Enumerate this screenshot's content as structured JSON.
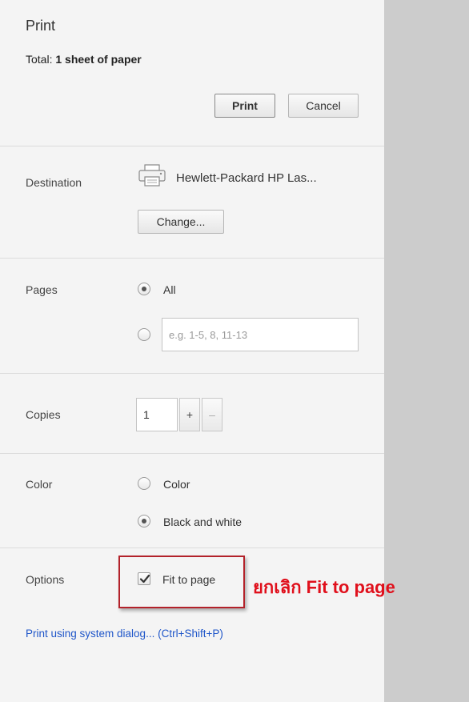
{
  "header": {
    "title": "Print",
    "total_label": "Total:",
    "total_value": "1 sheet of paper",
    "print_button": "Print",
    "cancel_button": "Cancel"
  },
  "destination": {
    "label": "Destination",
    "printer_name": "Hewlett-Packard HP Las...",
    "change_button": "Change..."
  },
  "pages": {
    "label": "Pages",
    "all_option": "All",
    "all_selected": true,
    "custom_placeholder": "e.g. 1-5, 8, 11-13"
  },
  "copies": {
    "label": "Copies",
    "value": "1",
    "increment": "+",
    "decrement": "–"
  },
  "color": {
    "label": "Color",
    "option_color": "Color",
    "option_bw": "Black and white",
    "selected": "Black and white"
  },
  "options": {
    "label": "Options",
    "fit_to_page": "Fit to page",
    "fit_to_page_checked": true
  },
  "annotation": {
    "text": "ยกเลิก Fit to page",
    "color": "#e0101c",
    "box_color": "#b3222a"
  },
  "system_dialog_link": "Print using system dialog... (Ctrl+Shift+P)",
  "icons": {
    "printer": "printer-icon",
    "checkmark": "checkmark-icon"
  },
  "colors": {
    "panel_bg": "#f4f4f4",
    "preview_bg": "#cccccc",
    "link": "#1f56c9"
  }
}
